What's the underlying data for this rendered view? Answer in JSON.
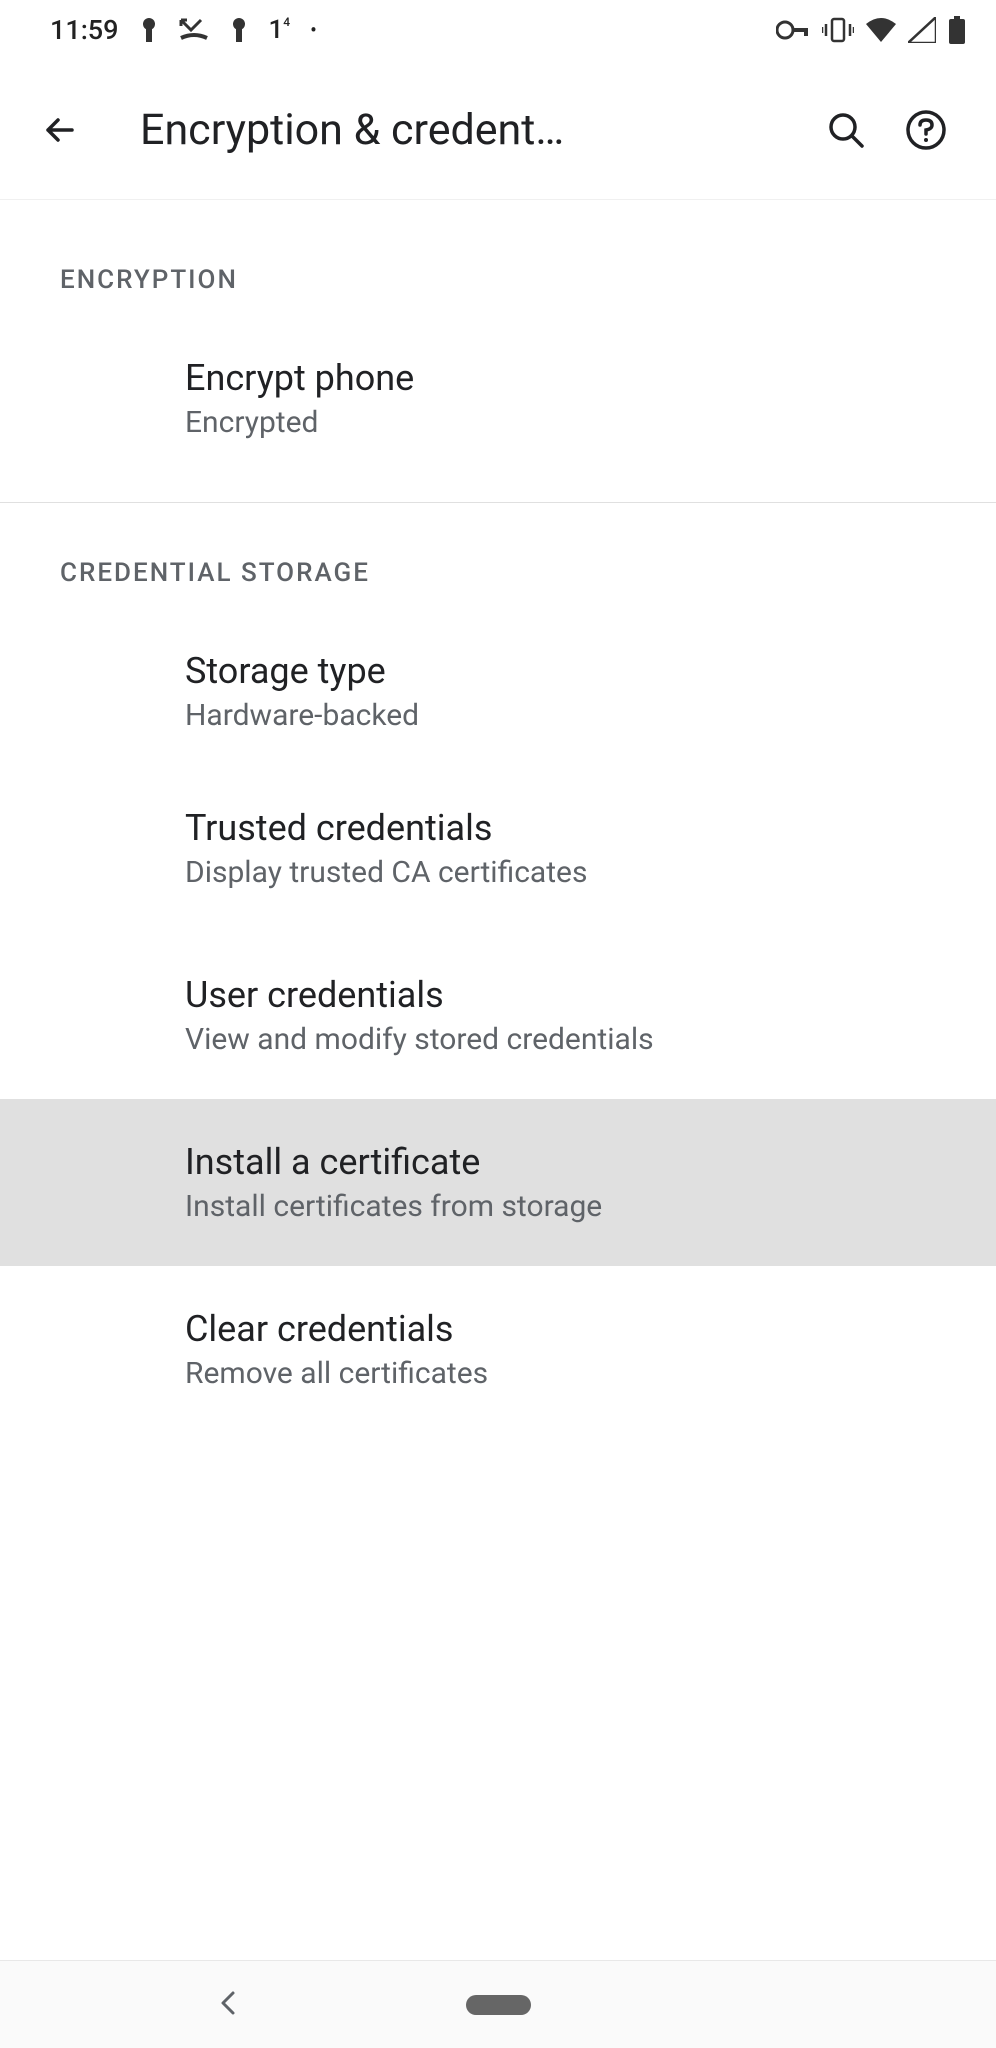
{
  "status_bar": {
    "time": "11:59",
    "icon_1": "key-icon",
    "icon_2": "missed-call-icon",
    "icon_3": "key-icon",
    "icon_4": "1",
    "icon_5": "dot",
    "right_icons": [
      "vpn-key",
      "vibrate",
      "wifi",
      "signal",
      "battery"
    ]
  },
  "header": {
    "title": "Encryption & credent…"
  },
  "sections": [
    {
      "header": "ENCRYPTION",
      "items": [
        {
          "title": "Encrypt phone",
          "subtitle": "Encrypted",
          "highlighted": false
        }
      ],
      "divider_after": true
    },
    {
      "header": "CREDENTIAL STORAGE",
      "items": [
        {
          "title": "Storage type",
          "subtitle": "Hardware-backed",
          "highlighted": false
        },
        {
          "title": "Trusted credentials",
          "subtitle": "Display trusted CA certificates",
          "highlighted": false
        },
        {
          "title": "User credentials",
          "subtitle": "View and modify stored credentials",
          "highlighted": false
        },
        {
          "title": "Install a certificate",
          "subtitle": "Install certificates from storage",
          "highlighted": true
        },
        {
          "title": "Clear credentials",
          "subtitle": "Remove all certificates",
          "highlighted": false
        }
      ],
      "divider_after": false
    }
  ]
}
